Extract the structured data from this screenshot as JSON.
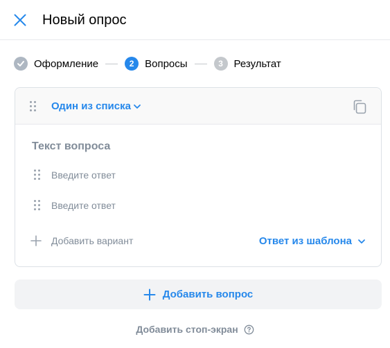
{
  "header": {
    "title": "Новый опрос"
  },
  "steps": [
    {
      "label": "Оформление",
      "number": "",
      "state": "done"
    },
    {
      "label": "Вопросы",
      "number": "2",
      "state": "active"
    },
    {
      "label": "Результат",
      "number": "3",
      "state": "todo"
    }
  ],
  "question_card": {
    "type_label": "Один из списка",
    "question_placeholder": "Текст вопроса",
    "answers": [
      {
        "placeholder": "Введите ответ"
      },
      {
        "placeholder": "Введите ответ"
      }
    ],
    "add_variant_label": "Добавить вариант",
    "template_label": "Ответ из шаблона"
  },
  "add_question_label": "Добавить вопрос",
  "add_stop_screen_label": "Добавить стоп-экран",
  "colors": {
    "accent": "#2688eb",
    "secondary": "#818c99",
    "border": "#dce1e6"
  }
}
